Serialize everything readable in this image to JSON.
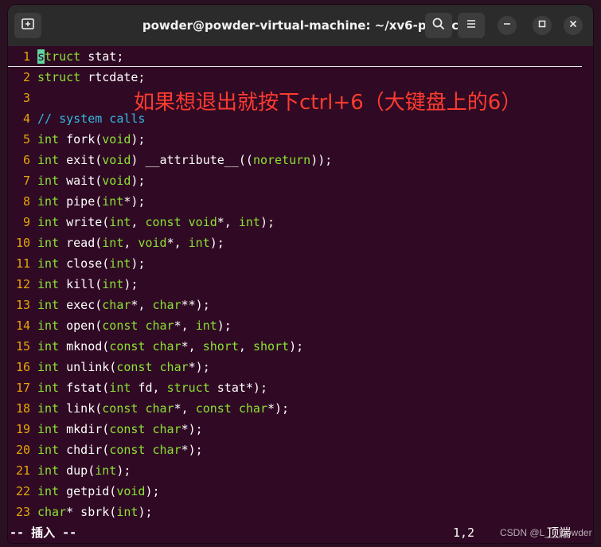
{
  "window": {
    "title": "powder@powder-virtual-machine: ~/xv6-public",
    "buttons": {
      "new_tab_icon": "new-tab-icon",
      "search_icon": "search-icon",
      "menu_icon": "hamburger-menu-icon",
      "minimize_icon": "minimize-icon",
      "maximize_icon": "maximize-icon",
      "close_icon": "close-icon"
    }
  },
  "annotation": "如果想退出就按下ctrl+6（大键盘上的6）",
  "lines": [
    {
      "num": "1",
      "parts": [
        {
          "t": "s",
          "c": "cursor"
        },
        {
          "t": "truct",
          "c": "kw"
        },
        {
          "t": " stat;",
          "c": ""
        }
      ]
    },
    {
      "num": "2",
      "parts": [
        {
          "t": "struct",
          "c": "kw"
        },
        {
          "t": " rtcdate;",
          "c": ""
        }
      ]
    },
    {
      "num": "3",
      "parts": []
    },
    {
      "num": "4",
      "parts": [
        {
          "t": "// system calls",
          "c": "cm"
        }
      ]
    },
    {
      "num": "5",
      "parts": [
        {
          "t": "int",
          "c": "kw"
        },
        {
          "t": " fork(",
          "c": ""
        },
        {
          "t": "void",
          "c": "kw"
        },
        {
          "t": ");",
          "c": ""
        }
      ]
    },
    {
      "num": "6",
      "parts": [
        {
          "t": "int",
          "c": "kw"
        },
        {
          "t": " exit(",
          "c": ""
        },
        {
          "t": "void",
          "c": "kw"
        },
        {
          "t": ") __attribute__((",
          "c": ""
        },
        {
          "t": "noreturn",
          "c": "kw"
        },
        {
          "t": "));",
          "c": ""
        }
      ]
    },
    {
      "num": "7",
      "parts": [
        {
          "t": "int",
          "c": "kw"
        },
        {
          "t": " wait(",
          "c": ""
        },
        {
          "t": "void",
          "c": "kw"
        },
        {
          "t": ");",
          "c": ""
        }
      ]
    },
    {
      "num": "8",
      "parts": [
        {
          "t": "int",
          "c": "kw"
        },
        {
          "t": " pipe(",
          "c": ""
        },
        {
          "t": "int",
          "c": "kw"
        },
        {
          "t": "*);",
          "c": ""
        }
      ]
    },
    {
      "num": "9",
      "parts": [
        {
          "t": "int",
          "c": "kw"
        },
        {
          "t": " write(",
          "c": ""
        },
        {
          "t": "int",
          "c": "kw"
        },
        {
          "t": ", ",
          "c": ""
        },
        {
          "t": "const",
          "c": "kw"
        },
        {
          "t": " ",
          "c": ""
        },
        {
          "t": "void",
          "c": "kw"
        },
        {
          "t": "*, ",
          "c": ""
        },
        {
          "t": "int",
          "c": "kw"
        },
        {
          "t": ");",
          "c": ""
        }
      ]
    },
    {
      "num": "10",
      "parts": [
        {
          "t": "int",
          "c": "kw"
        },
        {
          "t": " read(",
          "c": ""
        },
        {
          "t": "int",
          "c": "kw"
        },
        {
          "t": ", ",
          "c": ""
        },
        {
          "t": "void",
          "c": "kw"
        },
        {
          "t": "*, ",
          "c": ""
        },
        {
          "t": "int",
          "c": "kw"
        },
        {
          "t": ");",
          "c": ""
        }
      ]
    },
    {
      "num": "11",
      "parts": [
        {
          "t": "int",
          "c": "kw"
        },
        {
          "t": " close(",
          "c": ""
        },
        {
          "t": "int",
          "c": "kw"
        },
        {
          "t": ");",
          "c": ""
        }
      ]
    },
    {
      "num": "12",
      "parts": [
        {
          "t": "int",
          "c": "kw"
        },
        {
          "t": " kill(",
          "c": ""
        },
        {
          "t": "int",
          "c": "kw"
        },
        {
          "t": ");",
          "c": ""
        }
      ]
    },
    {
      "num": "13",
      "parts": [
        {
          "t": "int",
          "c": "kw"
        },
        {
          "t": " exec(",
          "c": ""
        },
        {
          "t": "char",
          "c": "kw"
        },
        {
          "t": "*, ",
          "c": ""
        },
        {
          "t": "char",
          "c": "kw"
        },
        {
          "t": "**);",
          "c": ""
        }
      ]
    },
    {
      "num": "14",
      "parts": [
        {
          "t": "int",
          "c": "kw"
        },
        {
          "t": " open(",
          "c": ""
        },
        {
          "t": "const",
          "c": "kw"
        },
        {
          "t": " ",
          "c": ""
        },
        {
          "t": "char",
          "c": "kw"
        },
        {
          "t": "*, ",
          "c": ""
        },
        {
          "t": "int",
          "c": "kw"
        },
        {
          "t": ");",
          "c": ""
        }
      ]
    },
    {
      "num": "15",
      "parts": [
        {
          "t": "int",
          "c": "kw"
        },
        {
          "t": " mknod(",
          "c": ""
        },
        {
          "t": "const",
          "c": "kw"
        },
        {
          "t": " ",
          "c": ""
        },
        {
          "t": "char",
          "c": "kw"
        },
        {
          "t": "*, ",
          "c": ""
        },
        {
          "t": "short",
          "c": "kw"
        },
        {
          "t": ", ",
          "c": ""
        },
        {
          "t": "short",
          "c": "kw"
        },
        {
          "t": ");",
          "c": ""
        }
      ]
    },
    {
      "num": "16",
      "parts": [
        {
          "t": "int",
          "c": "kw"
        },
        {
          "t": " unlink(",
          "c": ""
        },
        {
          "t": "const",
          "c": "kw"
        },
        {
          "t": " ",
          "c": ""
        },
        {
          "t": "char",
          "c": "kw"
        },
        {
          "t": "*);",
          "c": ""
        }
      ]
    },
    {
      "num": "17",
      "parts": [
        {
          "t": "int",
          "c": "kw"
        },
        {
          "t": " fstat(",
          "c": ""
        },
        {
          "t": "int",
          "c": "kw"
        },
        {
          "t": " fd, ",
          "c": ""
        },
        {
          "t": "struct",
          "c": "kw"
        },
        {
          "t": " stat*);",
          "c": ""
        }
      ]
    },
    {
      "num": "18",
      "parts": [
        {
          "t": "int",
          "c": "kw"
        },
        {
          "t": " link(",
          "c": ""
        },
        {
          "t": "const",
          "c": "kw"
        },
        {
          "t": " ",
          "c": ""
        },
        {
          "t": "char",
          "c": "kw"
        },
        {
          "t": "*, ",
          "c": ""
        },
        {
          "t": "const",
          "c": "kw"
        },
        {
          "t": " ",
          "c": ""
        },
        {
          "t": "char",
          "c": "kw"
        },
        {
          "t": "*);",
          "c": ""
        }
      ]
    },
    {
      "num": "19",
      "parts": [
        {
          "t": "int",
          "c": "kw"
        },
        {
          "t": " mkdir(",
          "c": ""
        },
        {
          "t": "const",
          "c": "kw"
        },
        {
          "t": " ",
          "c": ""
        },
        {
          "t": "char",
          "c": "kw"
        },
        {
          "t": "*);",
          "c": ""
        }
      ]
    },
    {
      "num": "20",
      "parts": [
        {
          "t": "int",
          "c": "kw"
        },
        {
          "t": " chdir(",
          "c": ""
        },
        {
          "t": "const",
          "c": "kw"
        },
        {
          "t": " ",
          "c": ""
        },
        {
          "t": "char",
          "c": "kw"
        },
        {
          "t": "*);",
          "c": ""
        }
      ]
    },
    {
      "num": "21",
      "parts": [
        {
          "t": "int",
          "c": "kw"
        },
        {
          "t": " dup(",
          "c": ""
        },
        {
          "t": "int",
          "c": "kw"
        },
        {
          "t": ");",
          "c": ""
        }
      ]
    },
    {
      "num": "22",
      "parts": [
        {
          "t": "int",
          "c": "kw"
        },
        {
          "t": " getpid(",
          "c": ""
        },
        {
          "t": "void",
          "c": "kw"
        },
        {
          "t": ");",
          "c": ""
        }
      ]
    },
    {
      "num": "23",
      "parts": [
        {
          "t": "char",
          "c": "kw"
        },
        {
          "t": "* sbrk(",
          "c": ""
        },
        {
          "t": "int",
          "c": "kw"
        },
        {
          "t": ");",
          "c": ""
        }
      ]
    }
  ],
  "status": {
    "mode": "-- 插入 --",
    "position": "1,2",
    "scroll": "顶端"
  },
  "watermark": "CSDN @L___powder",
  "colors": {
    "background": "#300a24",
    "line_number": "#e5a50a",
    "keyword": "#8ae234",
    "comment": "#34b7e4",
    "annotation": "#ff3b30",
    "cursor": "#5fd79f"
  }
}
